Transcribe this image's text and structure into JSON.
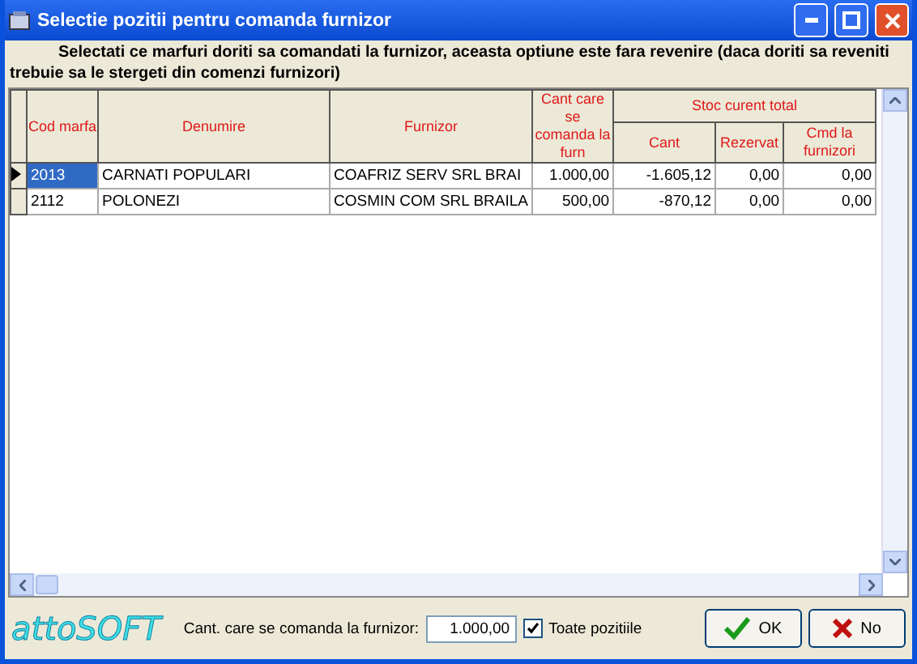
{
  "window": {
    "title": "Selectie pozitii pentru comanda furnizor"
  },
  "instruction": "Selectati ce marfuri doriti sa comandati la furnizor, aceasta optiune este fara revenire (daca doriti sa reveniti trebuie sa le stergeti din comenzi furnizori)",
  "table": {
    "columns": [
      "Cod marfa",
      "Denumire",
      "Furnizor",
      "Cant care se comanda la furn"
    ],
    "column_group": {
      "label": "Stoc curent total",
      "columns": [
        "Cant",
        "Rezervat",
        "Cmd la furnizori"
      ]
    },
    "rows": [
      {
        "selected": true,
        "cells": [
          "2013",
          "CARNATI POPULARI",
          "COAFRIZ SERV SRL BRAI",
          "1.000,00",
          "-1.605,12",
          "0,00",
          "0,00"
        ]
      },
      {
        "selected": false,
        "cells": [
          "2112",
          "POLONEZI",
          "COSMIN COM SRL BRAILA",
          "500,00",
          "-870,12",
          "0,00",
          "0,00"
        ]
      }
    ]
  },
  "footer": {
    "logo": "attoSOFT",
    "quantity_label": "Cant. care se comanda la furnizor:",
    "quantity_value": "1.000,00",
    "all_positions": {
      "label": "Toate pozitiile",
      "checked": true
    },
    "buttons": [
      "OK",
      "No"
    ]
  }
}
